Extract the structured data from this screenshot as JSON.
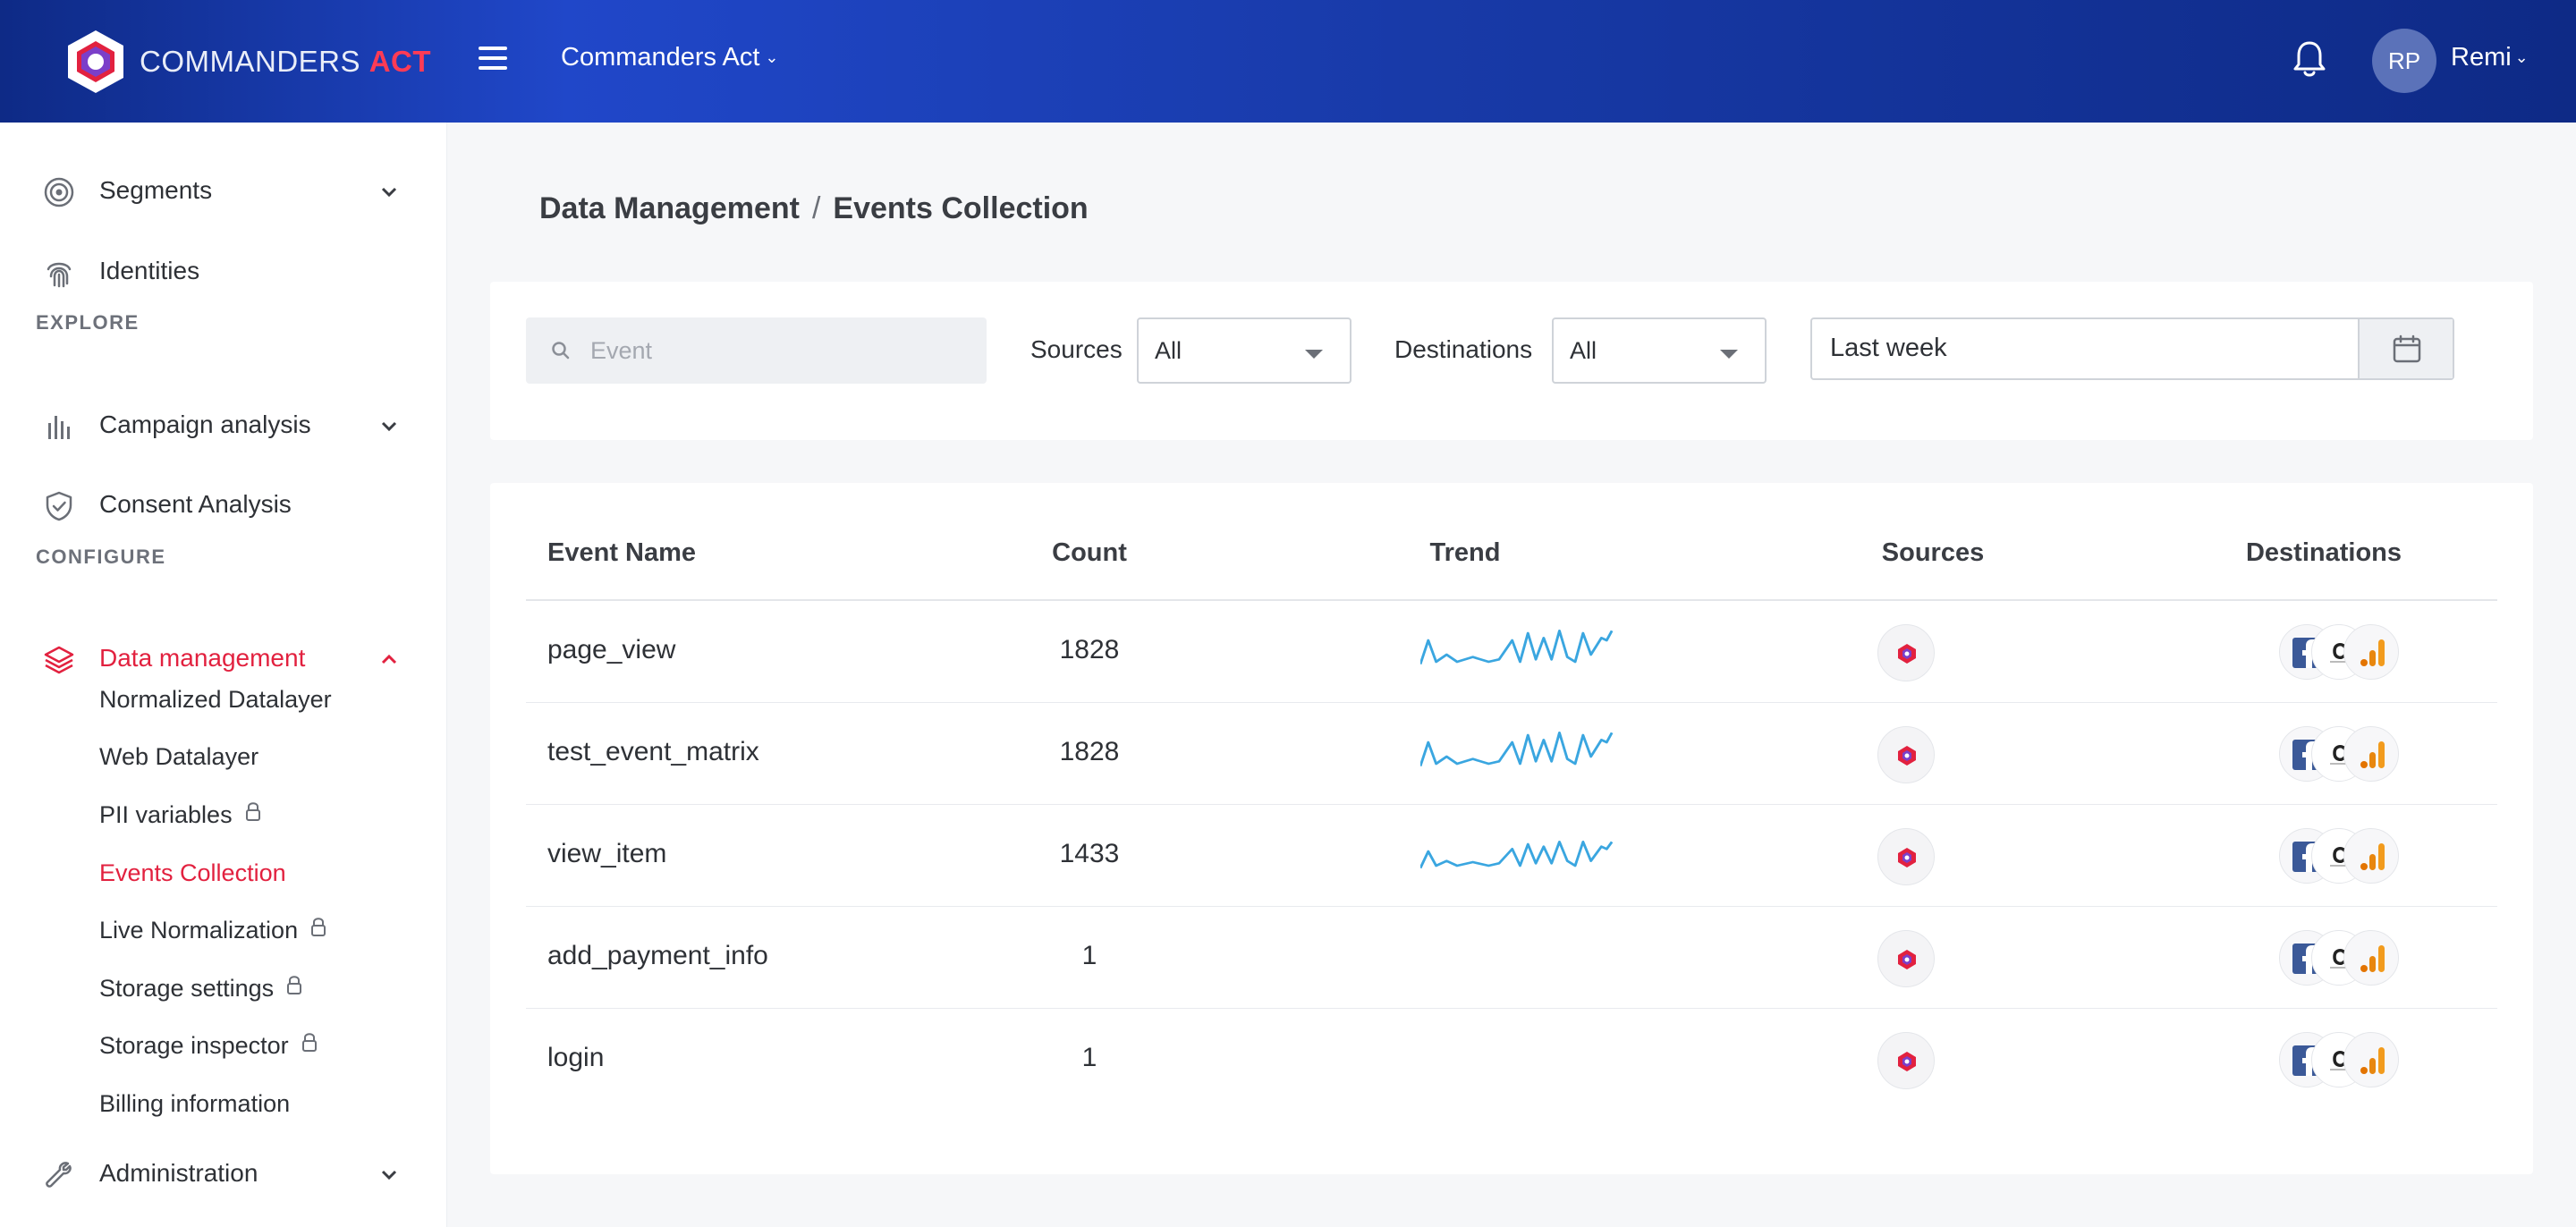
{
  "header": {
    "brand_main": "COMMANDERS",
    "brand_accent": "ACT",
    "workspace": "Commanders Act",
    "user_initials": "RP",
    "user_name": "Remi"
  },
  "sidebar": {
    "top_items": [
      {
        "label": "Segments",
        "icon": "target-icon"
      },
      {
        "label": "Identities",
        "icon": "fingerprint-icon"
      }
    ],
    "explore_label": "EXPLORE",
    "explore_items": [
      {
        "label": "Campaign analysis",
        "icon": "bar-chart-icon"
      },
      {
        "label": "Consent Analysis",
        "icon": "shield-check-icon"
      }
    ],
    "configure_label": "CONFIGURE",
    "data_management": {
      "label": "Data management",
      "icon": "layers-icon",
      "children": [
        "Normalized Datalayer",
        "Web Datalayer",
        "PII variables",
        "Events Collection",
        "Live Normalization",
        "Storage settings",
        "Storage inspector",
        "Billing information"
      ]
    },
    "administration": {
      "label": "Administration",
      "icon": "wrench-icon"
    }
  },
  "breadcrumb": {
    "parent": "Data Management",
    "separator": "/",
    "current": "Events Collection"
  },
  "filters": {
    "search_placeholder": "Event",
    "sources_label": "Sources",
    "sources_value": "All",
    "destinations_label": "Destinations",
    "destinations_value": "All",
    "date_range": "Last week"
  },
  "table": {
    "columns": [
      "Event Name",
      "Count",
      "Trend",
      "Sources",
      "Destinations"
    ],
    "rows": [
      {
        "name": "page_view",
        "count": "1828",
        "has_trend": true
      },
      {
        "name": "test_event_matrix",
        "count": "1828",
        "has_trend": true
      },
      {
        "name": "view_item",
        "count": "1433",
        "has_trend": true
      },
      {
        "name": "add_payment_info",
        "count": "1",
        "has_trend": false
      },
      {
        "name": "login",
        "count": "1",
        "has_trend": false
      }
    ]
  },
  "colors": {
    "accent": "#e2213f",
    "header_blue": "#183aa8",
    "sparkline": "#3aa6e0",
    "facebook": "#3b5998",
    "analytics_orange": "#f29b1d"
  }
}
